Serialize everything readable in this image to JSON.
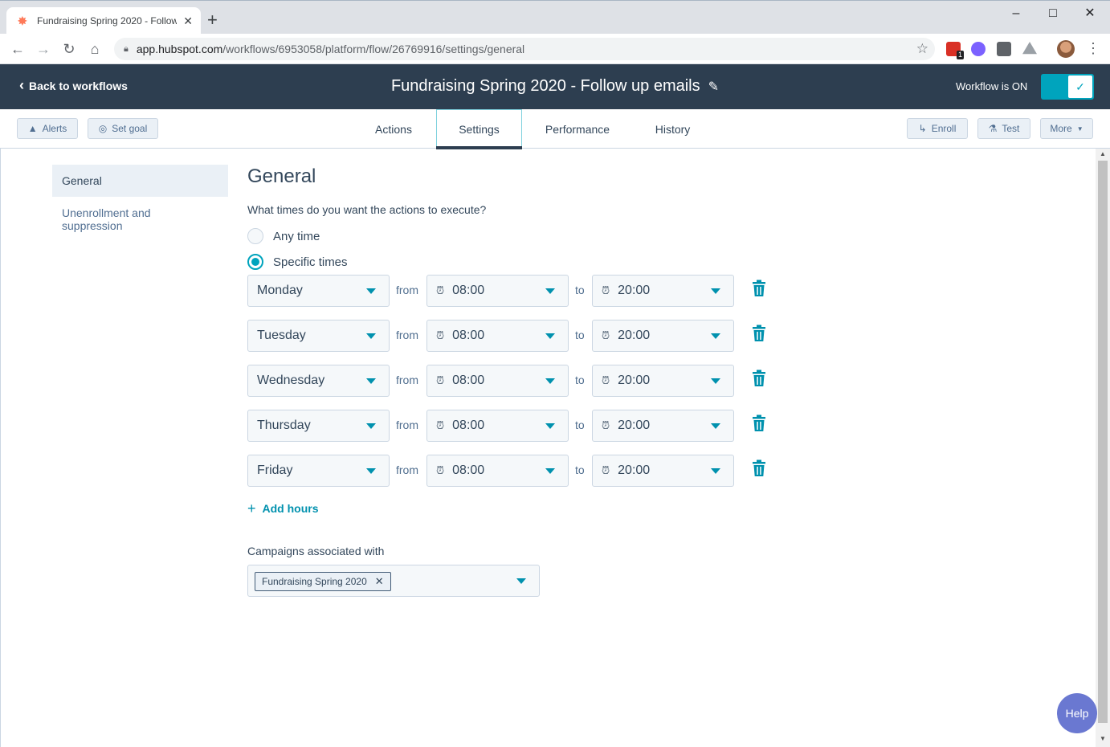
{
  "browser": {
    "tab_title": "Fundraising Spring 2020 - Follow",
    "url_host": "app.hubspot.com",
    "url_path": "/workflows/6953058/platform/flow/26769916/settings/general"
  },
  "header": {
    "back_label": "Back to workflows",
    "title": "Fundraising Spring 2020 - Follow up emails",
    "status_label": "Workflow is ON"
  },
  "toolbar": {
    "alerts_label": "Alerts",
    "setgoal_label": "Set goal",
    "tabs": [
      {
        "label": "Actions"
      },
      {
        "label": "Settings"
      },
      {
        "label": "Performance"
      },
      {
        "label": "History"
      }
    ],
    "enroll_label": "Enroll",
    "test_label": "Test",
    "more_label": "More"
  },
  "sidebar": {
    "items": [
      {
        "label": "General"
      },
      {
        "label": "Unenrollment and suppression"
      }
    ]
  },
  "general": {
    "heading": "General",
    "question": "What times do you want the actions to execute?",
    "option_any": "Any time",
    "option_specific": "Specific times",
    "from_label": "from",
    "to_label": "to",
    "rows": [
      {
        "day": "Monday",
        "from": "08:00",
        "to": "20:00"
      },
      {
        "day": "Tuesday",
        "from": "08:00",
        "to": "20:00"
      },
      {
        "day": "Wednesday",
        "from": "08:00",
        "to": "20:00"
      },
      {
        "day": "Thursday",
        "from": "08:00",
        "to": "20:00"
      },
      {
        "day": "Friday",
        "from": "08:00",
        "to": "20:00"
      }
    ],
    "add_hours": "Add hours",
    "campaigns_label": "Campaigns associated with",
    "campaign_chip": "Fundraising Spring 2020"
  },
  "help_label": "Help",
  "extensions": {
    "badge_count": "1"
  },
  "colors": {
    "accent": "#00a4bd",
    "header_bg": "#2d3e50",
    "link": "#0091ae"
  }
}
